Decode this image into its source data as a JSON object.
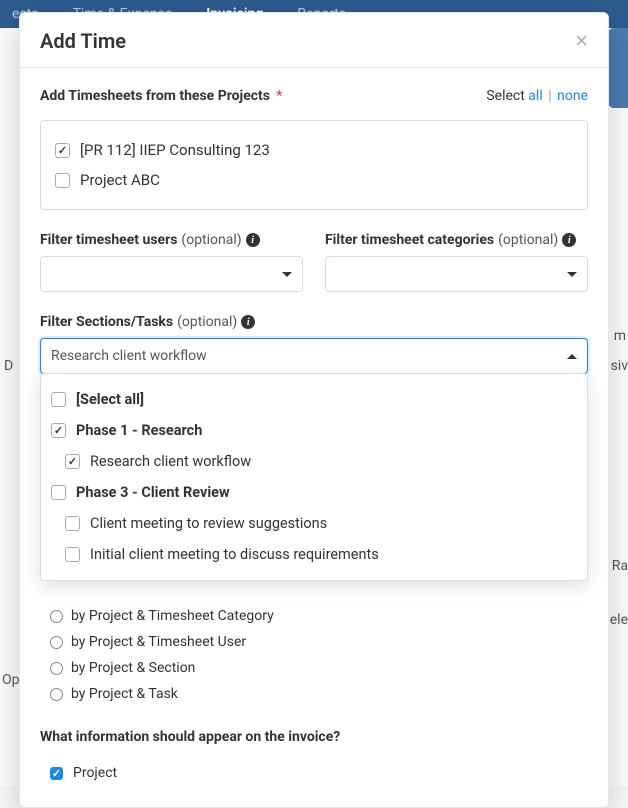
{
  "nav": {
    "items": [
      "ects",
      "Time & Expense",
      "Invoicing",
      "Reports"
    ]
  },
  "bg": {
    "left1": "D",
    "left2": "Op",
    "right1": "m",
    "right2": "siv",
    "right3": "Ra",
    "right4": "ele"
  },
  "modal": {
    "title": "Add Time",
    "projects_label": "Add Timesheets from these Projects",
    "select_text": "Select",
    "select_all": "all",
    "select_none": "none",
    "projects": [
      {
        "label": "[PR 112] IIEP Consulting 123",
        "checked": true
      },
      {
        "label": "Project ABC",
        "checked": false
      }
    ],
    "filter_users_label": "Filter timesheet users",
    "filter_categories_label": "Filter timesheet categories",
    "filter_sections_label": "Filter Sections/Tasks",
    "optional": "(optional)",
    "sections_value": "Research client workflow",
    "section_options": [
      {
        "label": "[Select all]",
        "bold": true,
        "indent": 0,
        "checked": false
      },
      {
        "label": "Phase 1 - Research",
        "bold": true,
        "indent": 0,
        "checked": true
      },
      {
        "label": "Research client workflow",
        "bold": false,
        "indent": 1,
        "checked": true
      },
      {
        "label": "Phase 3 - Client Review",
        "bold": true,
        "indent": 0,
        "checked": false
      },
      {
        "label": "Client meeting to review suggestions",
        "bold": false,
        "indent": 1,
        "checked": false
      },
      {
        "label": "Initial client meeting to discuss requirements",
        "bold": false,
        "indent": 1,
        "checked": false
      }
    ],
    "group_radios": [
      "by Project & Timesheet Category",
      "by Project & Timesheet User",
      "by Project & Section",
      "by Project & Task"
    ],
    "info_question": "What information should appear on the invoice?",
    "info_checks": [
      {
        "label": "Project",
        "checked": true
      }
    ]
  }
}
